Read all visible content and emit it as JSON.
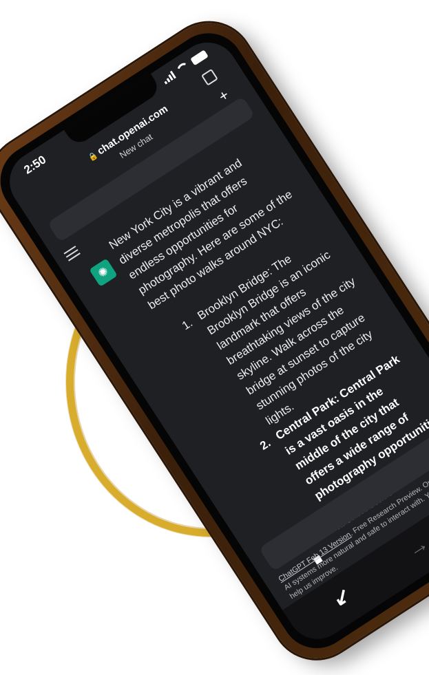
{
  "status": {
    "time": "2:50"
  },
  "browser": {
    "url": "chat.openai.com",
    "tab_title": "New chat"
  },
  "message": {
    "intro": "New York City is a vibrant and diverse metropolis that offers endless opportunities for photography. Here are some of the best photo walks around NYC:",
    "items": [
      {
        "number": "1.",
        "text": "Brooklyn Bridge: The Brooklyn Bridge is an iconic landmark that offers breathtaking views of the city skyline. Walk across the bridge at sunset to capture stunning photos of the city lights."
      },
      {
        "number": "2.",
        "text": "Central Park: Central Park is a vast oasis in the middle of the city that offers a wide range of photography opportunities, from nature scenes to architecture"
      }
    ]
  },
  "footer": {
    "version_link": "ChatGPT Feb 13 Version",
    "text": ". Free Research Preview. Our goal is to make AI systems more natural and safe to interact with. Your feedback will help us improve."
  },
  "colors": {
    "ring": "#d8ad2e",
    "phone_case": "#5a3312",
    "screen": "#1f2024",
    "avatar": "#10a37f"
  },
  "icons": [
    "lock-icon",
    "plus-icon",
    "share-icon",
    "menu-icon",
    "openai-logo-icon",
    "back-arrow-icon",
    "forward-arrow-icon"
  ]
}
